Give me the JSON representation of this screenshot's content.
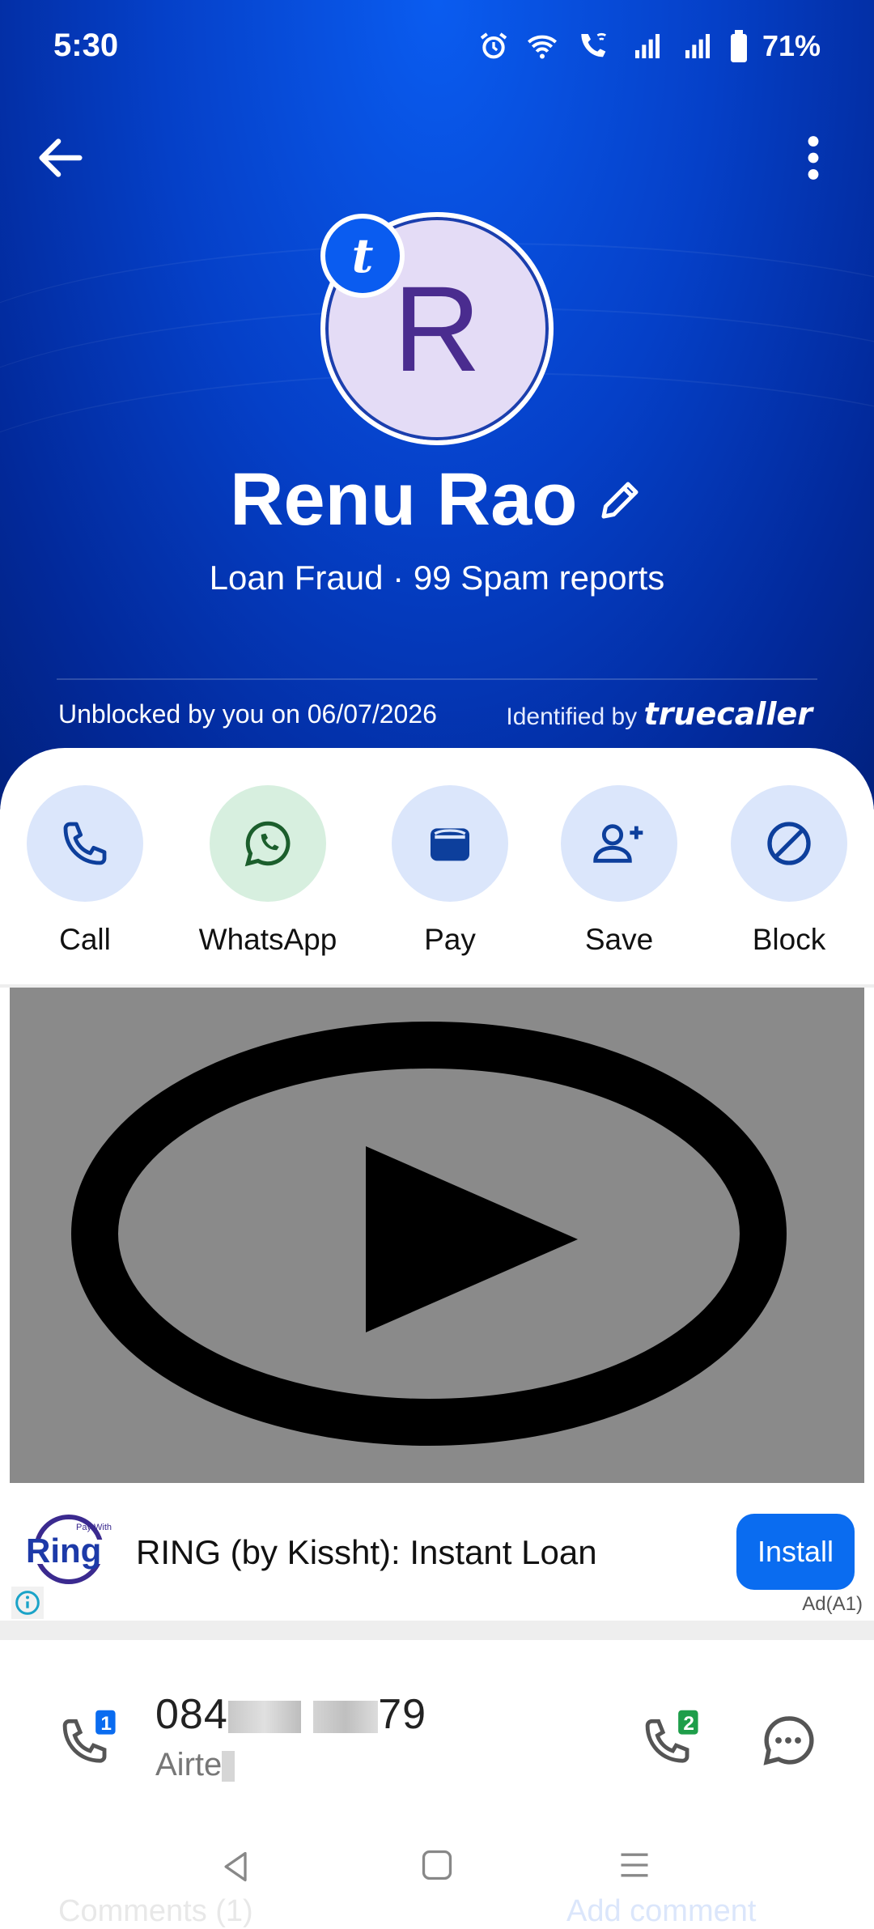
{
  "status_bar": {
    "time": "5:30",
    "battery": "71%",
    "icons": [
      "alarm-icon",
      "wifi-icon",
      "wifi-calling-icon",
      "signal-icon",
      "signal-icon",
      "battery-icon"
    ]
  },
  "header": {
    "avatar_letter": "R",
    "badge_letter": "t",
    "name": "Renu Rao",
    "spam_info": "Loan Fraud · 99 Spam reports",
    "unblocked_text": "Unblocked by you on 06/07/2026",
    "identified_prefix": "Identified by",
    "identified_brand": "truecaller"
  },
  "actions": [
    {
      "label": "Call",
      "icon": "phone-icon"
    },
    {
      "label": "WhatsApp",
      "icon": "whatsapp-icon"
    },
    {
      "label": "Pay",
      "icon": "wallet-icon"
    },
    {
      "label": "Save",
      "icon": "add-contact-icon"
    },
    {
      "label": "Block",
      "icon": "block-icon"
    }
  ],
  "ad": {
    "title": "RING (by Kissht): Instant Loan",
    "install_label": "Install",
    "ad_label": "Ad(A1)",
    "logo_small": "Pay With",
    "logo_text": "Ring"
  },
  "contact": {
    "number_start": "084",
    "number_end": "79",
    "carrier": "Airte",
    "sim1": "1",
    "sim2": "2"
  },
  "bottom": {
    "comments": "Comments (1)",
    "add_comment": "Add comment"
  },
  "colors": {
    "header_blue": "#0540c8",
    "action_bg": "#dbe6fb",
    "whatsapp_bg": "#d7efdf",
    "install_blue": "#0a6cf0"
  }
}
